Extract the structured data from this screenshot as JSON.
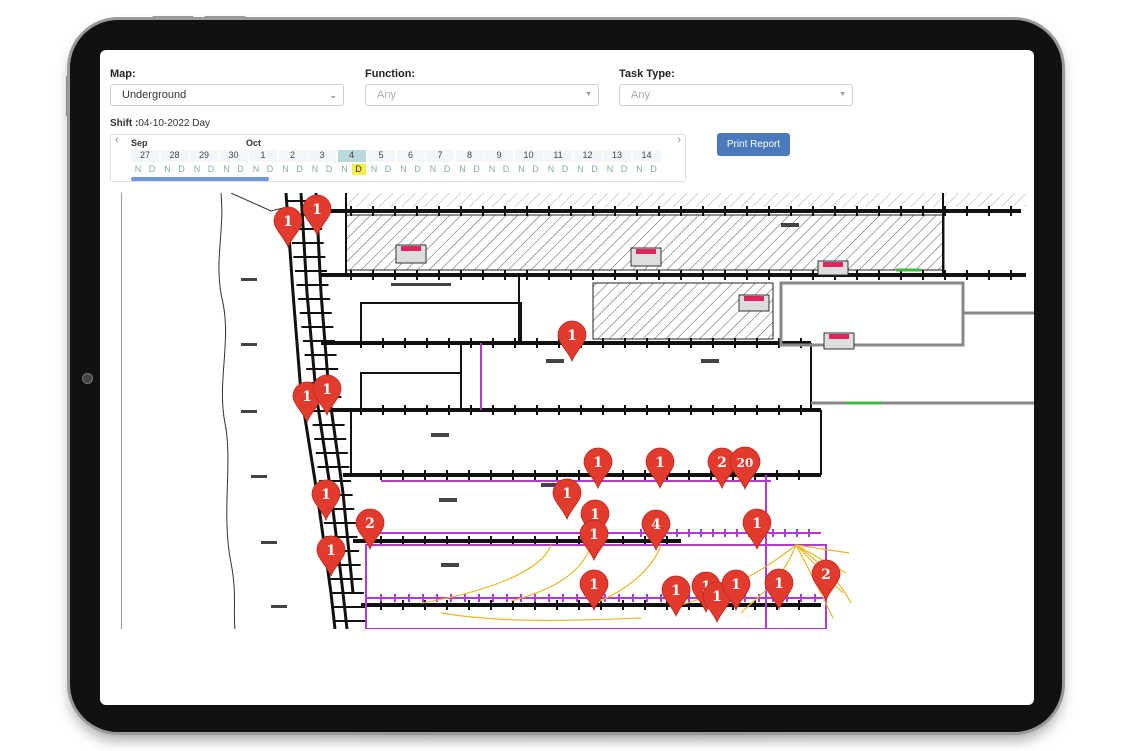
{
  "filters": {
    "map": {
      "label": "Map:",
      "value": "Underground"
    },
    "function": {
      "label": "Function:",
      "placeholder": "Any"
    },
    "task_type": {
      "label": "Task Type:",
      "placeholder": "Any"
    }
  },
  "shift": {
    "label": "Shift :",
    "value": "04-10-2022 Day"
  },
  "calendar": {
    "months": [
      {
        "name": "Sep"
      },
      {
        "name": "Oct"
      }
    ],
    "days": [
      "27",
      "28",
      "29",
      "30",
      "1",
      "2",
      "3",
      "4",
      "5",
      "6",
      "7",
      "8",
      "9",
      "10",
      "11",
      "12",
      "13",
      "14"
    ],
    "selected_day": "4",
    "shift_letters": [
      "N",
      "D"
    ],
    "selected_shift": "D"
  },
  "actions": {
    "print_report": "Print Report"
  },
  "map_markers": [
    {
      "count": "1"
    },
    {
      "count": "1"
    },
    {
      "count": "1"
    },
    {
      "count": "1"
    },
    {
      "count": "1"
    },
    {
      "count": "1"
    },
    {
      "count": "1"
    },
    {
      "count": "1"
    },
    {
      "count": "2"
    },
    {
      "count": "20"
    },
    {
      "count": "1"
    },
    {
      "count": "2"
    },
    {
      "count": "1"
    },
    {
      "count": "4"
    },
    {
      "count": "1"
    },
    {
      "count": "1"
    },
    {
      "count": "1"
    },
    {
      "count": "1"
    },
    {
      "count": "1"
    },
    {
      "count": "1"
    },
    {
      "count": "1"
    },
    {
      "count": "1"
    },
    {
      "count": "2"
    },
    {
      "count": "1"
    }
  ],
  "colors": {
    "marker": "#e23b2e",
    "accent": "#4a79bd",
    "highlight": "#f4ef4c",
    "ventilation": "#b13ad6",
    "cable": "#e8b829"
  }
}
